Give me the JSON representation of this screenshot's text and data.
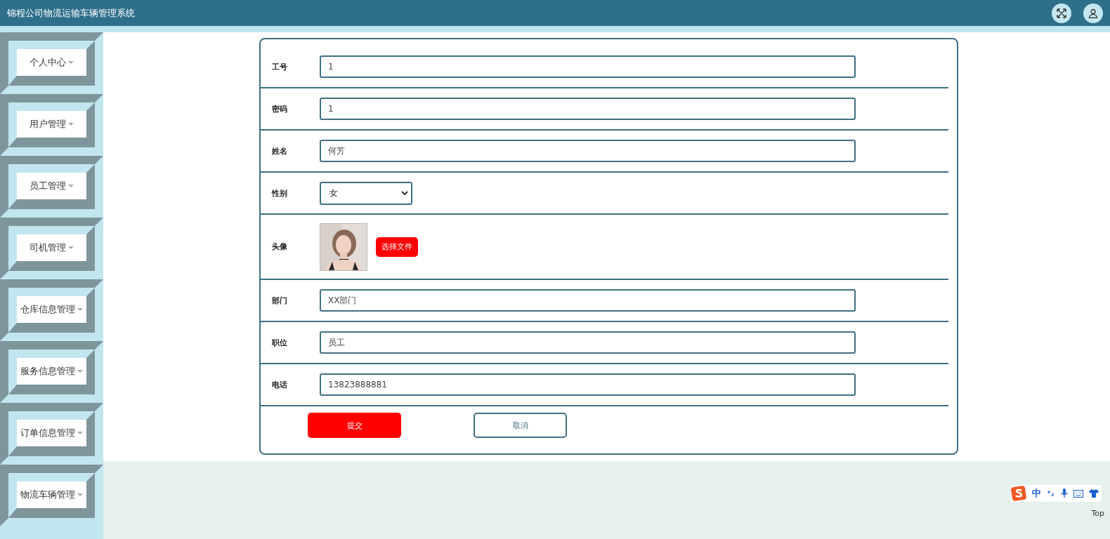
{
  "header": {
    "title": "锦程公司物流运输车辆管理系统"
  },
  "sidebar": {
    "items": [
      {
        "label": "个人中心"
      },
      {
        "label": "用户管理"
      },
      {
        "label": "员工管理"
      },
      {
        "label": "司机管理"
      },
      {
        "label": "仓库信息管理"
      },
      {
        "label": "服务信息管理"
      },
      {
        "label": "订单信息管理"
      },
      {
        "label": "物流车辆管理"
      }
    ]
  },
  "form": {
    "fields": [
      {
        "kind": "text",
        "label": "工号",
        "value": "1"
      },
      {
        "kind": "text",
        "label": "密码",
        "value": "1"
      },
      {
        "kind": "text",
        "label": "姓名",
        "value": "何芳"
      },
      {
        "kind": "select",
        "label": "性别",
        "value": "女"
      },
      {
        "label": "头像",
        "button": "选择文件"
      },
      {
        "kind": "text",
        "label": "部门",
        "value": "XX部门"
      },
      {
        "kind": "text",
        "label": "职位",
        "value": "员工"
      },
      {
        "kind": "text",
        "label": "电话",
        "value": "13823888881"
      }
    ],
    "actions": [
      {
        "kind": "primary",
        "label": "提交"
      },
      {
        "kind": "secondary",
        "label": "取消"
      }
    ]
  },
  "ime_bar": {
    "mode": "中"
  },
  "back_to_top": "Top"
}
